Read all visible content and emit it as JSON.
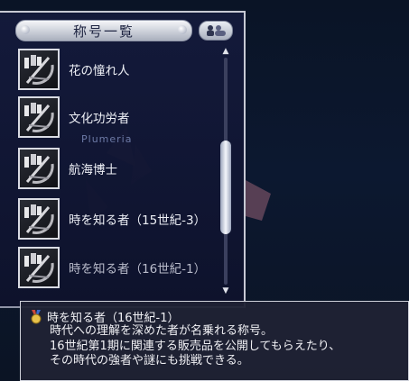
{
  "window": {
    "title": "称号一覧"
  },
  "watermark": "Plumeria",
  "titles_list": [
    {
      "label": "花の憧れ人",
      "dimmed": false
    },
    {
      "label": "文化功労者",
      "dimmed": false
    },
    {
      "label": "航海博士",
      "dimmed": false
    },
    {
      "label": "時を知る者（15世紀-3）",
      "dimmed": false
    },
    {
      "label": "時を知る者（16世紀-1）",
      "dimmed": true
    }
  ],
  "scrollbar": {
    "position": 0.62
  },
  "tooltip": {
    "title": "時を知る者（16世紀-1）",
    "lines": [
      "時代への理解を深めた者が名乗れる称号。",
      "16世紀第1期に関連する販売品を公開してもらえたり、",
      "その時代の強者や謎にも挑戦できる。"
    ]
  },
  "colors": {
    "panel": "#141a3c",
    "text": "#eef0f6",
    "frame": "#c7c9d4"
  }
}
